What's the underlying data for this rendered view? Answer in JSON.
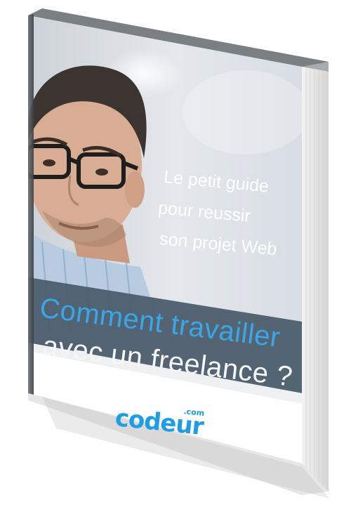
{
  "cover": {
    "subtitle_lines": [
      "Le petit guide",
      "pour reussir",
      "son projet Web"
    ],
    "headline_lines": [
      "Comment travailler",
      "avec un freelance ?"
    ],
    "logo_text": "codeur",
    "logo_tld": ".com"
  },
  "colors": {
    "headline_accent": "#3aa6e8",
    "logo_blue": "#1e9de4",
    "band_gray": "#4c5d6d",
    "page_edge": "#e9e9e9"
  },
  "icons": [
    "portrait-photo",
    "book-spine",
    "page-edges"
  ]
}
